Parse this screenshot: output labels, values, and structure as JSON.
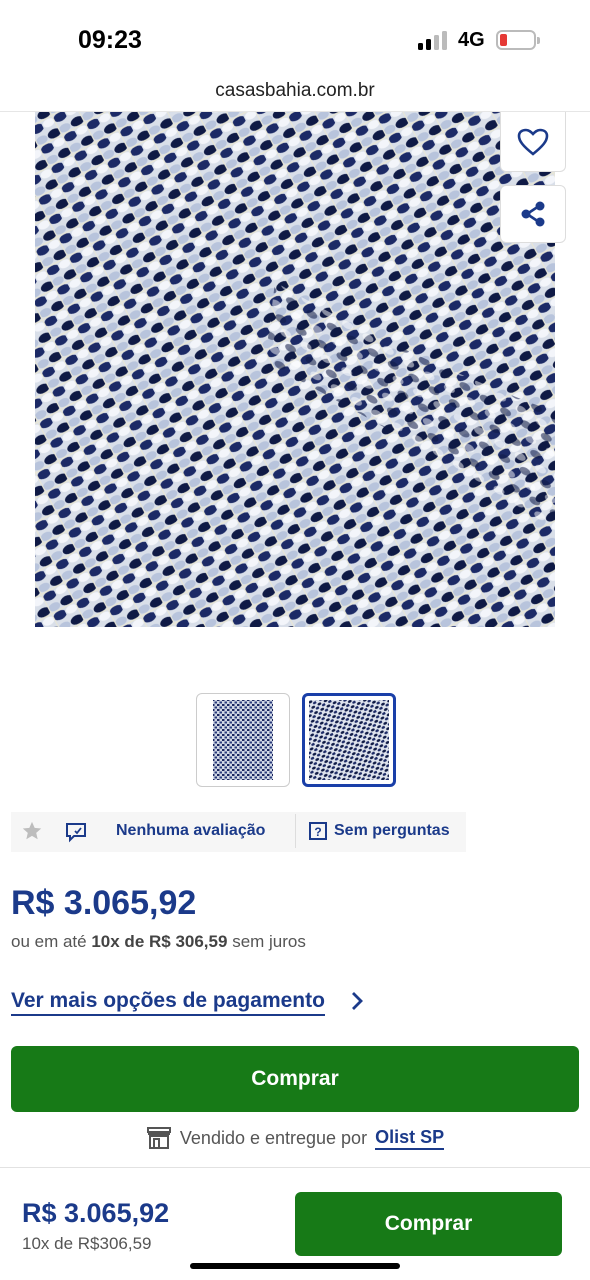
{
  "status": {
    "time": "09:23",
    "network": "4G",
    "battery_level": 0.15
  },
  "browser": {
    "url": "casasbahia.com.br"
  },
  "product": {
    "image_description_icon": "woven-rug-texture",
    "thumbnail_count": 2,
    "selected_thumbnail": 2
  },
  "rating": {
    "reviews_label": "Nenhuma avaliação",
    "questions_label": "Sem perguntas"
  },
  "price": {
    "main": "R$ 3.065,92",
    "installments_prefix": "ou em até",
    "installments_strong": "10x de R$ 306,59",
    "installments_suffix": "sem juros",
    "more_options": "Ver mais opções de pagamento"
  },
  "buy": {
    "label": "Comprar"
  },
  "seller": {
    "prefix": "Vendido e entregue por",
    "name": "Olist SP"
  },
  "sticky": {
    "price": "R$ 3.065,92",
    "installments": "10x de R$306,59",
    "buy_label": "Comprar"
  },
  "colors": {
    "brand_blue": "#1b3a8a",
    "buy_green": "#177a17",
    "rug_navy": "#0f1a45",
    "rug_light": "#c9d3e6"
  }
}
